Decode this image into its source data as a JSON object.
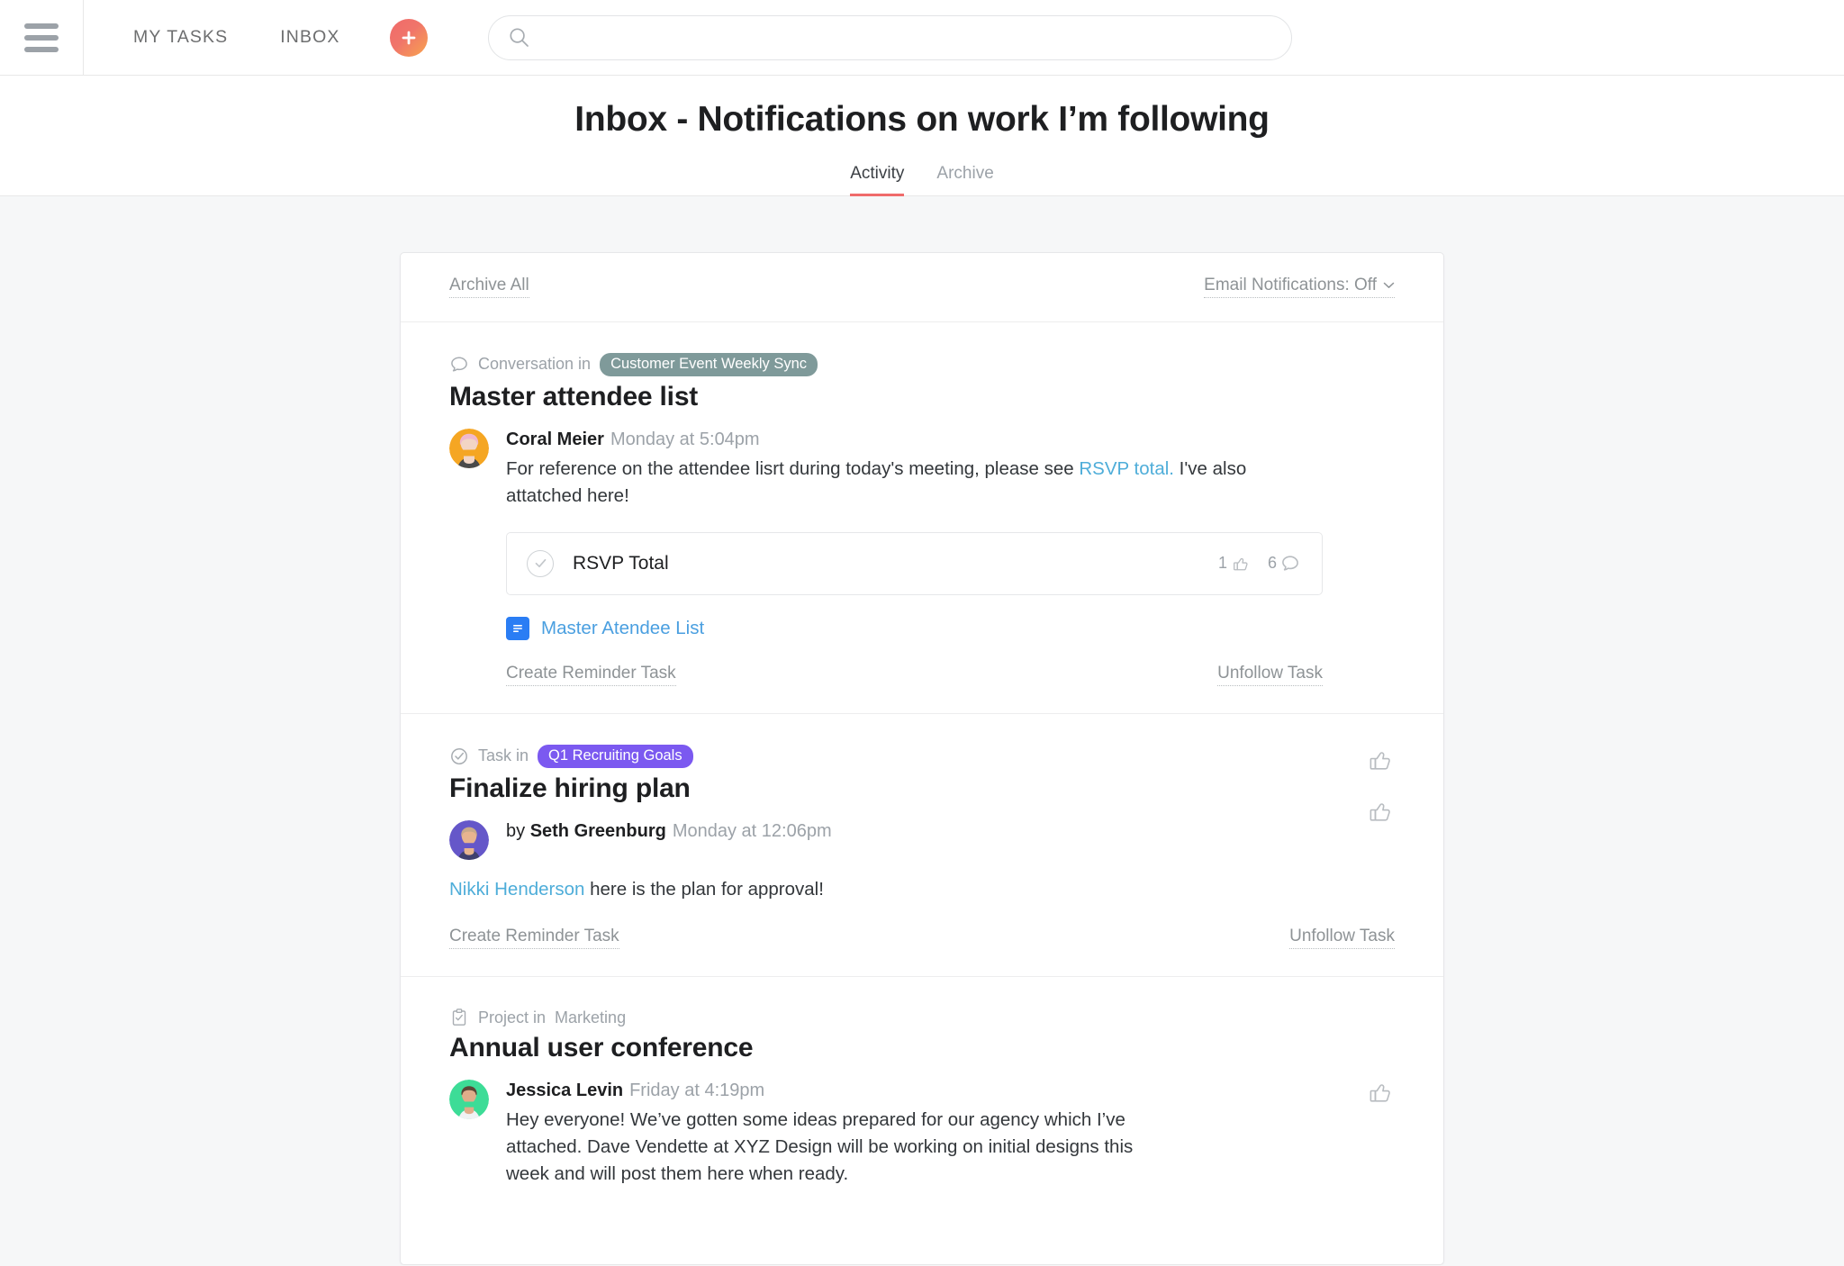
{
  "topbar": {
    "menu_icon": "hamburger-icon",
    "nav": [
      {
        "label": "MY TASKS",
        "name": "my-tasks"
      },
      {
        "label": "INBOX",
        "name": "inbox"
      }
    ],
    "add_button_icon": "plus-icon",
    "search": {
      "icon": "search-icon",
      "value": "",
      "placeholder": ""
    }
  },
  "header": {
    "title": "Inbox - Notifications on work I’m following",
    "tabs": [
      {
        "label": "Activity",
        "active": true
      },
      {
        "label": "Archive",
        "active": false
      }
    ]
  },
  "toolbar": {
    "archive_all": "Archive All",
    "email_notifications": "Email Notifications: Off",
    "chevron_icon": "chevron-down-icon"
  },
  "colors": {
    "accent": "#ef6b6b",
    "link": "#4eadd9",
    "pill_teal": "#7f9a9a",
    "pill_purple": "#7b59f0",
    "page_bg": "#f6f7f8",
    "text": "#1e1f21",
    "muted": "#9ca2a8",
    "gdoc_blue": "#2a7df4"
  },
  "notifications": [
    {
      "meta_icon": "conversation-icon",
      "meta_prefix": "Conversation in",
      "pill": "Customer Event Weekly Sync",
      "pill_style": "teal",
      "title": "Master attendee list",
      "author": "Coral Meier",
      "by_prefix": "",
      "time": "Monday at 5:04pm",
      "avatar_color": "#f5a623",
      "message_before": "For reference on the attendee lisrt during today's meeting, please see ",
      "message_link": "RSVP total.",
      "message_after": " I've also attatched here!",
      "task_card": {
        "name": "RSVP Total",
        "likes": "1",
        "comments": "6",
        "check_icon": "check-circle-icon",
        "like_icon": "thumbs-up-icon",
        "comment_icon": "comment-icon"
      },
      "attachment": {
        "icon": "google-doc-icon",
        "name": "Master Atendee List"
      },
      "create_reminder": "Create Reminder Task",
      "unfollow": "Unfollow Task",
      "thumb_icon": "thumbs-up-icon"
    },
    {
      "meta_icon": "task-check-icon",
      "meta_prefix": "Task in",
      "pill": "Q1 Recruiting Goals",
      "pill_style": "purple",
      "title": "Finalize hiring plan",
      "author": "Seth Greenburg",
      "by_prefix": "by ",
      "time": "Monday at 12:06pm",
      "avatar_color": "#6557c9",
      "mention": "Nikki Henderson",
      "message_after": " here is the plan for approval!",
      "create_reminder": "Create Reminder Task",
      "unfollow": "Unfollow Task",
      "thumb_icon": "thumbs-up-icon"
    },
    {
      "meta_icon": "project-clipboard-icon",
      "meta_prefix": "Project in",
      "project_plain": "Marketing",
      "title": "Annual user conference",
      "author": "Jessica Levin",
      "by_prefix": "",
      "time": "Friday at 4:19pm",
      "avatar_color": "#3ddc97",
      "message_full": "Hey everyone! We’ve gotten some ideas prepared for our agency which I’ve attached. Dave Vendette at XYZ Design will be working on initial designs this week and will post them here when ready.",
      "thumb_icon": "thumbs-up-icon"
    }
  ]
}
